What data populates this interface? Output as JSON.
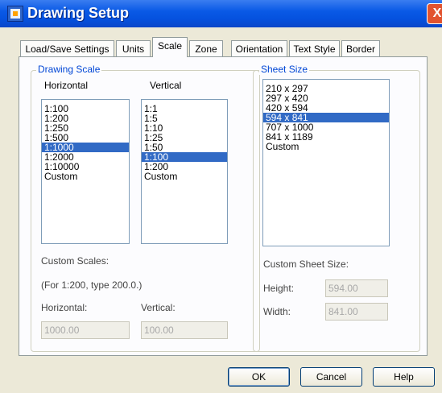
{
  "window": {
    "title": "Drawing Setup",
    "close_label": "X"
  },
  "tabs": [
    {
      "label": "Load/Save Settings"
    },
    {
      "label": "Units"
    },
    {
      "label": "Scale",
      "active": true
    },
    {
      "label": "Zone"
    },
    {
      "label": "Orientation"
    },
    {
      "label": "Text Style"
    },
    {
      "label": "Border"
    }
  ],
  "drawing_scale": {
    "legend": "Drawing Scale",
    "horizontal_label": "Horizontal",
    "vertical_label": "Vertical",
    "horizontal_items": [
      "1:100",
      "1:200",
      "1:250",
      "1:500",
      "1:1000",
      "1:2000",
      "1:10000",
      "Custom"
    ],
    "horizontal_selected": "1:1000",
    "vertical_items": [
      "1:1",
      "1:5",
      "1:10",
      "1:25",
      "1:50",
      "1:100",
      "1:200",
      "Custom"
    ],
    "vertical_selected": "1:100",
    "custom_scales_label": "Custom Scales:",
    "custom_hint": "(For 1:200, type 200.0.)",
    "custom_horizontal_label": "Horizontal:",
    "custom_vertical_label": "Vertical:",
    "custom_horizontal_value": "1000.00",
    "custom_vertical_value": "100.00"
  },
  "sheet_size": {
    "legend": "Sheet Size",
    "items": [
      "210 x 297",
      "297 x 420",
      "420 x 594",
      "594 x 841",
      "707 x 1000",
      "841 x 1189",
      "Custom"
    ],
    "selected": "594 x 841",
    "custom_label": "Custom Sheet Size:",
    "height_label": "Height:",
    "width_label": "Width:",
    "height_value": "594.00",
    "width_value": "841.00"
  },
  "buttons": {
    "ok": "OK",
    "cancel": "Cancel",
    "help": "Help"
  },
  "colors": {
    "title_bar": "#0a5ae6",
    "selection": "#316ac5",
    "legend_text": "#0046d5",
    "dialog_bg": "#ece9d8"
  }
}
